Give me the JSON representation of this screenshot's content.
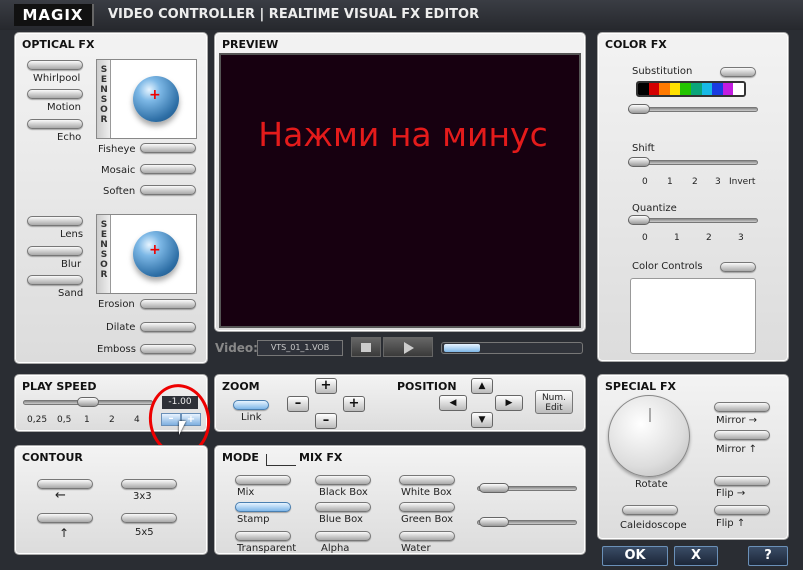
{
  "app": {
    "logo": "MAGIX",
    "title": "VIDEO CONTROLLER | REALTIME VISUAL FX EDITOR"
  },
  "optical_fx": {
    "title": "OPTICAL FX",
    "sensor_label": "SENSOR",
    "left_top": [
      "Whirlpool",
      "Motion",
      "Echo"
    ],
    "right_top": [
      "Fisheye",
      "Mosaic",
      "Soften"
    ],
    "left_bottom": [
      "Lens",
      "Blur",
      "Sand"
    ],
    "right_bottom": [
      "Erosion",
      "Dilate",
      "Emboss"
    ]
  },
  "preview": {
    "title": "PREVIEW",
    "overlay_text": "Нажми на минус",
    "video_label": "Video:",
    "file_name": "VTS_01_1.VOB",
    "stop_icon": "stop-icon",
    "play_icon": "play-icon"
  },
  "color_fx": {
    "title": "COLOR FX",
    "substitution": "Substitution",
    "shift": "Shift",
    "shift_ticks": [
      "0",
      "1",
      "2",
      "3",
      "Invert"
    ],
    "quantize": "Quantize",
    "quantize_ticks": [
      "0",
      "1",
      "2",
      "3"
    ],
    "color_controls": "Color Controls",
    "palette": [
      "#000000",
      "#d40000",
      "#ff7a00",
      "#ffe000",
      "#24c400",
      "#0aa57a",
      "#17b9e6",
      "#1a3ce0",
      "#c21ce0",
      "#ffffff"
    ]
  },
  "play_speed": {
    "title": "PLAY SPEED",
    "value": "-1.00",
    "ticks": [
      "0,25",
      "0,5",
      "1",
      "2",
      "4"
    ],
    "minus_label": "–",
    "plus_label": "+"
  },
  "zoom": {
    "title": "ZOOM",
    "link": "Link",
    "plus": "+",
    "minus": "–"
  },
  "position": {
    "title": "POSITION",
    "num_edit": "Num. Edit",
    "up": "▲",
    "down": "▼",
    "left": "◀",
    "right": "▶"
  },
  "special_fx": {
    "title": "SPECIAL FX",
    "rotate": "Rotate",
    "caleidoscope": "Caleidoscope",
    "mirror1": "Mirror",
    "mirror2": "Mirror",
    "flip1": "Flip",
    "flip2": "Flip"
  },
  "contour": {
    "title": "CONTOUR",
    "x3": "3x3",
    "x5": "5x5"
  },
  "mode": {
    "title": "MODE",
    "items": [
      "Mix",
      "Stamp",
      "Transparent"
    ]
  },
  "mix_fx": {
    "title": "MIX FX",
    "col1": [
      "Black Box",
      "Blue Box",
      "Alpha"
    ],
    "col2": [
      "White Box",
      "Green Box",
      "Water"
    ]
  },
  "footer": {
    "ok": "OK",
    "cancel": "X",
    "help": "?"
  }
}
